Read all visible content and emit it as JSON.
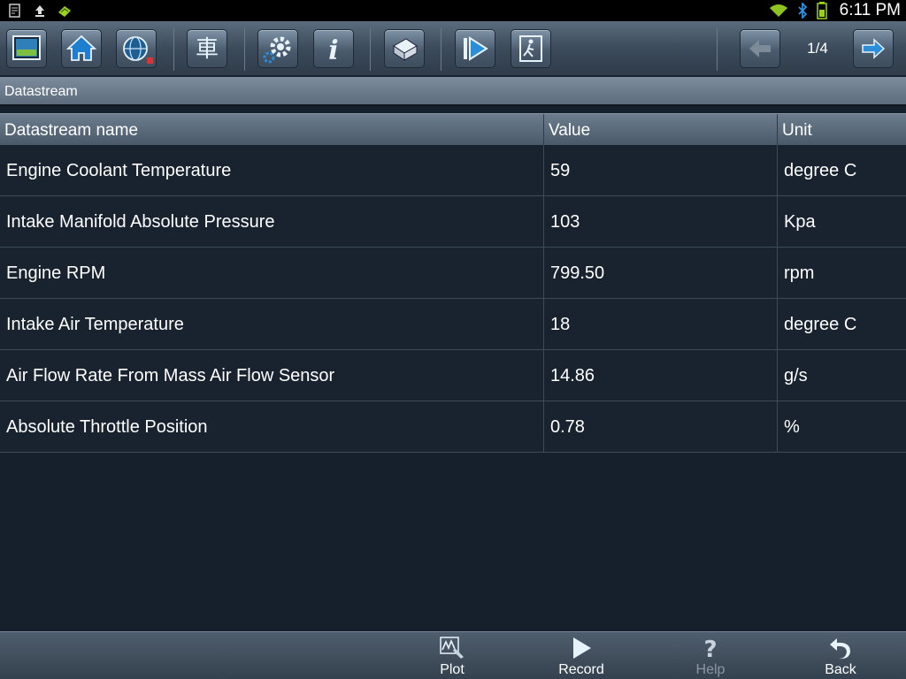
{
  "status_bar": {
    "time": "6:11 PM",
    "icons": [
      "notification-icon",
      "upload-icon",
      "android-icon",
      "wifi-icon",
      "bluetooth-icon",
      "battery-icon"
    ]
  },
  "toolbar": {
    "buttons": [
      "display-icon",
      "home-icon",
      "globe-icon",
      "vehicle-icon",
      "settings-icon",
      "info-icon",
      "print-icon",
      "play-pause-icon",
      "exit-icon"
    ],
    "page_indicator": "1/4",
    "prev_icon": "arrow-left-icon",
    "next_icon": "arrow-right-icon"
  },
  "title": "Datastream",
  "table": {
    "headers": [
      "Datastream name",
      "Value",
      "Unit"
    ],
    "rows": [
      {
        "name": "Engine Coolant Temperature",
        "value": "59",
        "unit": "degree C"
      },
      {
        "name": "Intake Manifold Absolute Pressure",
        "value": "103",
        "unit": "Kpa"
      },
      {
        "name": "Engine RPM",
        "value": "799.50",
        "unit": "rpm"
      },
      {
        "name": "Intake Air Temperature",
        "value": "18",
        "unit": "degree C"
      },
      {
        "name": "Air Flow Rate From Mass Air Flow Sensor",
        "value": "14.86",
        "unit": "g/s"
      },
      {
        "name": "Absolute Throttle Position",
        "value": "0.78",
        "unit": "%"
      }
    ]
  },
  "bottom_bar": {
    "plot": "Plot",
    "record": "Record",
    "help": "Help",
    "back": "Back"
  },
  "colors": {
    "background": "#16202d",
    "toolbar": "#3c4b5b",
    "accent_blue": "#2a8fd8",
    "disabled_text": "#8a96a3"
  }
}
